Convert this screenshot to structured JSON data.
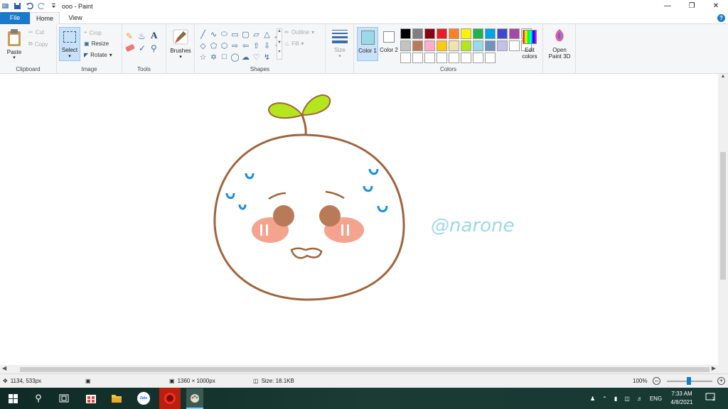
{
  "window": {
    "title": "ooo - Paint"
  },
  "tabs": {
    "file": "File",
    "home": "Home",
    "view": "View"
  },
  "ribbon": {
    "clipboard": {
      "paste": "Paste",
      "cut": "Cut",
      "copy": "Copy",
      "group": "Clipboard"
    },
    "image": {
      "select": "Select",
      "crop": "Crop",
      "resize": "Resize",
      "rotate": "Rotate",
      "group": "Image"
    },
    "tools": {
      "group": "Tools"
    },
    "brushes": {
      "label": "Brushes"
    },
    "shapes": {
      "outline": "Outline",
      "fill": "Fill",
      "group": "Shapes"
    },
    "size": {
      "label": "Size"
    },
    "colors": {
      "color1": "Color 1",
      "color2": "Color 2",
      "edit": "Edit colors",
      "group": "Colors",
      "color1_value": "#99d9ea",
      "color2_value": "#ffffff",
      "palette": [
        "#000000",
        "#7f7f7f",
        "#880015",
        "#ed1c24",
        "#ff7f27",
        "#fff200",
        "#22b14c",
        "#00a2e8",
        "#3f48cc",
        "#a349a4",
        "#ffffff",
        "#c3c3c3",
        "#b97a57",
        "#ffaec9",
        "#ffc90e",
        "#efe4b0",
        "#b5e61d",
        "#99d9ea",
        "#7092be",
        "#c8bfe7",
        "#ffffff",
        "#ffffff",
        "#ffffff",
        "#ffffff",
        "#ffffff",
        "#ffffff",
        "#ffffff",
        "#ffffff",
        "#ffffff",
        "#ffffff"
      ]
    },
    "paint3d": {
      "label": "Open Paint 3D"
    }
  },
  "canvas": {
    "signature": "@narone"
  },
  "status": {
    "cursor": "1134, 533px",
    "dimensions": "1360 × 1000px",
    "size": "Size: 18.1KB",
    "zoom": "100%"
  },
  "taskbar": {
    "lang": "ENG",
    "time": "7:33 AM",
    "date": "4/8/2021",
    "notifications": "2",
    "zalo": "Zalo"
  }
}
